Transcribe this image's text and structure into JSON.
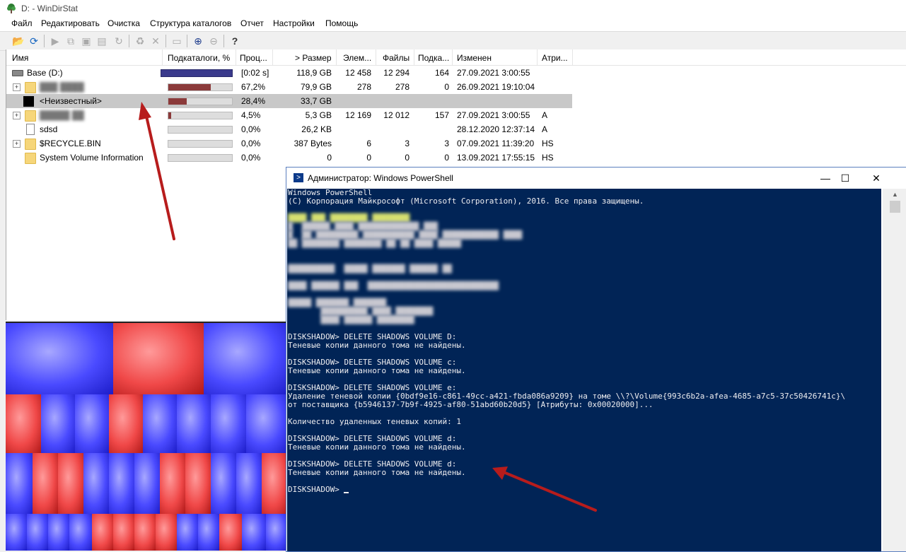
{
  "window": {
    "title": "D: - WinDirStat"
  },
  "menu": [
    "Файл",
    "Редактировать",
    "Очистка",
    "Структура каталогов",
    "Отчет",
    "Настройки",
    "Помощь"
  ],
  "toolbar": {
    "icons": [
      "open-icon",
      "refresh-icon",
      "play-icon",
      "copy-path-icon",
      "explorer-icon",
      "cmd-icon",
      "refresh-selected-icon",
      "recycle-icon",
      "delete-icon",
      "new-folder-icon",
      "zoom-in-icon",
      "zoom-out-icon",
      "help-icon"
    ]
  },
  "columns": [
    "Имя",
    "Подкаталоги, %",
    "Проц...",
    "> Размер",
    "Элем...",
    "Файлы",
    "Подка...",
    "Изменен",
    "Атри..."
  ],
  "rows": [
    {
      "name": "Base (D:)",
      "pct": "",
      "proc": "[0:02 s]",
      "size": "118,9 GB",
      "items": "12 458",
      "files": "12 294",
      "subdirs": "164",
      "modified": "27.09.2021 3:00:55",
      "attr": "",
      "bar": 1.0
    },
    {
      "name": "",
      "pct": "",
      "proc": "67,2%",
      "size": "79,9 GB",
      "items": "278",
      "files": "278",
      "subdirs": "0",
      "modified": "26.09.2021 19:10:04",
      "attr": "",
      "bar": 0.672
    },
    {
      "name": "<Неизвестный>",
      "pct": "",
      "proc": "28,4%",
      "size": "33,7 GB",
      "items": "",
      "files": "",
      "subdirs": "",
      "modified": "",
      "attr": "",
      "bar": 0.284
    },
    {
      "name": "",
      "pct": "",
      "proc": "4,5%",
      "size": "5,3 GB",
      "items": "12 169",
      "files": "12 012",
      "subdirs": "157",
      "modified": "27.09.2021 3:00:55",
      "attr": "A",
      "bar": 0.045
    },
    {
      "name": "sdsd",
      "pct": "",
      "proc": "0,0%",
      "size": "26,2 KB",
      "items": "",
      "files": "",
      "subdirs": "",
      "modified": "28.12.2020 12:37:14",
      "attr": "A",
      "bar": 0.0
    },
    {
      "name": "$RECYCLE.BIN",
      "pct": "",
      "proc": "0,0%",
      "size": "387 Bytes",
      "items": "6",
      "files": "3",
      "subdirs": "3",
      "modified": "07.09.2021 11:39:20",
      "attr": "HS",
      "bar": 0.0
    },
    {
      "name": "System Volume Information",
      "pct": "",
      "proc": "0,0%",
      "size": "0",
      "items": "0",
      "files": "0",
      "subdirs": "0",
      "modified": "13.09.2021 17:55:15",
      "attr": "HS",
      "bar": 0.0
    }
  ],
  "powershell": {
    "title": "Администратор: Windows PowerShell",
    "controls": {
      "minimize": "—",
      "maximize": "☐",
      "close": "✕"
    },
    "header_lines": [
      "Windows PowerShell",
      "(C) Корпорация Майкрософт (Microsoft Corporation), 2016. Все права защищены."
    ],
    "output_lines": [
      "DISKSHADOW> DELETE SHADOWS VOLUME D:",
      "Теневые копии данного тома не найдены.",
      "",
      "DISKSHADOW> DELETE SHADOWS VOLUME c:",
      "Теневые копии данного тома не найдены.",
      "",
      "DISKSHADOW> DELETE SHADOWS VOLUME e:",
      "Удаление теневой копии {0bdf9e16-c861-49cc-a421-fbda086a9209} на томе \\\\?\\Volume{993c6b2a-afea-4685-a7c5-37c50426741c}\\",
      "от поставщика {b5946137-7b9f-4925-af80-51abd60b20d5} [Атрибуты: 0x00020000]...",
      "",
      "Количество удаленных теневых копий: 1",
      "",
      "DISKSHADOW> DELETE SHADOWS VOLUME d:",
      "Теневые копии данного тома не найдены.",
      "",
      "DISKSHADOW> DELETE SHADOWS VOLUME d:",
      "Теневые копии данного тома не найдены.",
      ""
    ],
    "prompt": "DISKSHADOW> "
  },
  "colors": {
    "console_bg": "#012456",
    "bar_fill": "#8b3a3a",
    "root_bar_fill": "#3a3a8c",
    "arrow": "#b71c1c",
    "treemap_blue": "#4a4aff",
    "treemap_red": "#f04848"
  }
}
